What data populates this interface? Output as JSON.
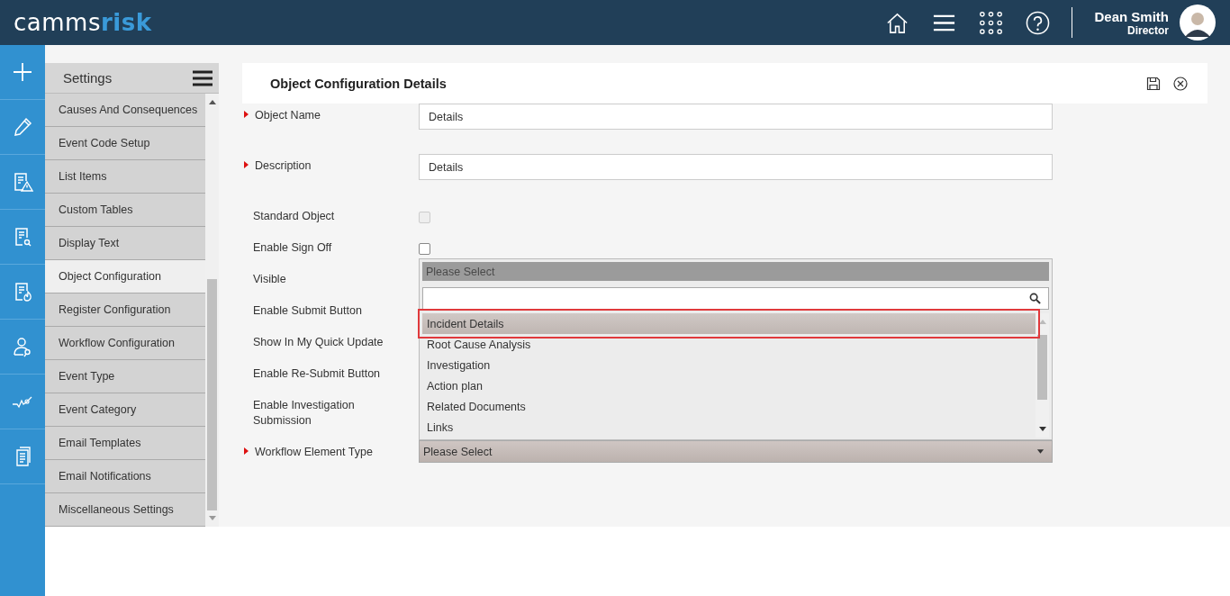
{
  "header": {
    "logo": {
      "main": "camms",
      "accent": "risk"
    },
    "user": {
      "name": "Dean Smith",
      "role": "Director"
    }
  },
  "sidebar": {
    "title": "Settings",
    "items": [
      {
        "label": "Causes And Consequences",
        "selected": false
      },
      {
        "label": "Event Code Setup",
        "selected": false
      },
      {
        "label": "List Items",
        "selected": false
      },
      {
        "label": "Custom Tables",
        "selected": false
      },
      {
        "label": "Display Text",
        "selected": false
      },
      {
        "label": "Object Configuration",
        "selected": true
      },
      {
        "label": "Register Configuration",
        "selected": false
      },
      {
        "label": "Workflow Configuration",
        "selected": false
      },
      {
        "label": "Event Type",
        "selected": false
      },
      {
        "label": "Event Category",
        "selected": false
      },
      {
        "label": "Email Templates",
        "selected": false
      },
      {
        "label": "Email Notifications",
        "selected": false
      },
      {
        "label": "Miscellaneous Settings",
        "selected": false
      }
    ]
  },
  "panel": {
    "title": "Object Configuration Details"
  },
  "fields": [
    {
      "label": "Object Name",
      "required": true,
      "kind": "text",
      "value": "Details"
    },
    {
      "label": "Description",
      "required": true,
      "kind": "text",
      "value": "Details"
    },
    {
      "label": "Standard Object",
      "required": false,
      "kind": "checkbox",
      "checked": false,
      "disabled": true
    },
    {
      "label": "Enable Sign Off",
      "required": false,
      "kind": "checkbox",
      "checked": false,
      "disabled": false
    },
    {
      "label": "Visible",
      "required": false,
      "kind": "hidden"
    },
    {
      "label": "Enable Submit Button",
      "required": false,
      "kind": "hidden"
    },
    {
      "label": "Show In My Quick Update",
      "required": false,
      "kind": "hidden"
    },
    {
      "label": "Enable Re-Submit Button",
      "required": false,
      "kind": "hidden"
    },
    {
      "label": "Enable Investigation Submission",
      "required": false,
      "kind": "hidden"
    },
    {
      "label": "Workflow Element Type",
      "required": true,
      "kind": "select",
      "value": "Please Select"
    }
  ],
  "dropdown": {
    "header": "Please Select",
    "options": [
      {
        "label": "Incident Details",
        "selected": true
      },
      {
        "label": "Root Cause Analysis",
        "selected": false
      },
      {
        "label": "Investigation",
        "selected": false
      },
      {
        "label": "Action plan",
        "selected": false
      },
      {
        "label": "Related Documents",
        "selected": false
      },
      {
        "label": "Links",
        "selected": false
      }
    ]
  }
}
